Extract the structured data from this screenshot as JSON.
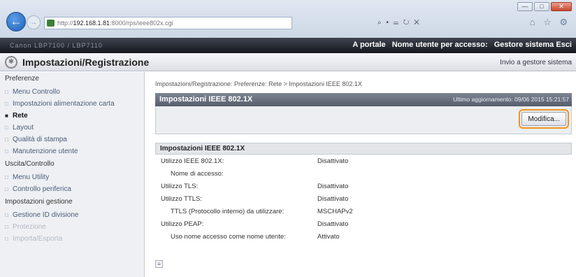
{
  "browser": {
    "url_prefix": "http://",
    "url_host": "192.168.1.81",
    "url_rest": ":8000/rps/ieee802x.cgi",
    "address_tools": "⌕ • ☰ ↻ ✕",
    "toolbar_icons": "⌂ ☆ ⚙",
    "win_min": "—",
    "win_max": "□",
    "win_close": "✕"
  },
  "topbar": {
    "device_name": "Canon LBP7100 / LBP7110",
    "portal_link": "A portale",
    "user_label": "Nome utente per accesso:",
    "user_value": "Gestore sistema Esci"
  },
  "header": {
    "title": "Impostazioni/Registrazione",
    "right_link": "Invio a gestore sistema"
  },
  "sidebar": {
    "sec_pref": "Preferenze",
    "sec_io": "Uscita/Controllo",
    "sec_mgmt": "Impostazioni gestione",
    "pref_items": [
      "Menu Controllo",
      "Impostazioni alimentazione carta",
      "Rete",
      "Layout",
      "Qualità di stampa",
      "Manutenzione utente"
    ],
    "io_items": [
      "Menu Utility",
      "Controllo periferica"
    ],
    "mgmt_items": [
      "Gestione ID divisione",
      "Protezione",
      "Importa/Esporta"
    ]
  },
  "main": {
    "breadcrumb": "Impostazioni/Registrazione: Preferenze: Rete > Impostazioni IEEE 802.1X",
    "panel_title": "Impostazioni IEEE 802.1X",
    "last_update": "Ultimo aggiornamento: 09/06 2015 15:21:57",
    "edit_button": "Modifica...",
    "section_title": "Impostazioni IEEE 802.1X",
    "rows": [
      {
        "k": "Utilizzo IEEE 802.1X:",
        "v": "Disattivato"
      },
      {
        "k": "Nome di accesso:",
        "v": ""
      },
      {
        "k": "Utilizzo TLS:",
        "v": "Disattivato"
      },
      {
        "k": "Utilizzo TTLS:",
        "v": "Disattivato"
      },
      {
        "k": "TTLS (Protocollo interno) da utilizzare:",
        "v": "MSCHAPv2"
      },
      {
        "k": "Utilizzo PEAP:",
        "v": "Disattivato"
      },
      {
        "k": "Uso nome accesso come nome utente:",
        "v": "Attivato"
      }
    ]
  }
}
